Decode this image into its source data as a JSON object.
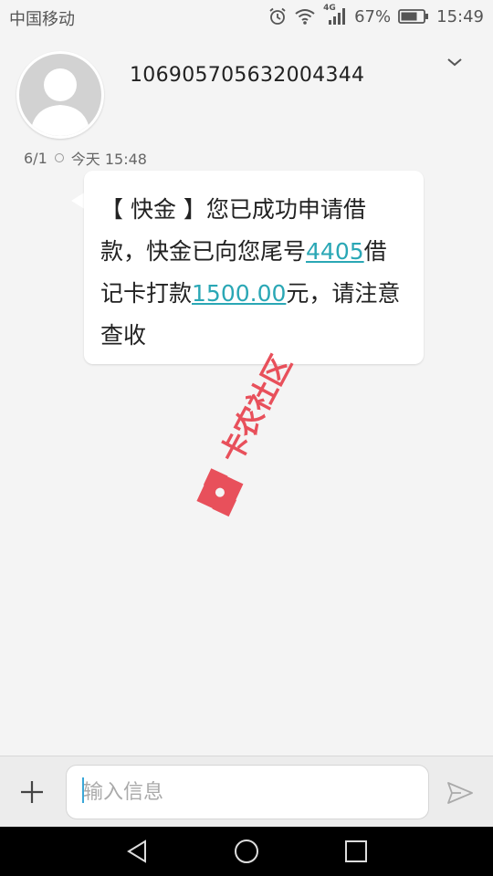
{
  "status_bar": {
    "carrier": "中国移动",
    "network": "4G",
    "battery": "67%",
    "time": "15:49"
  },
  "header": {
    "contact": "106905705632004344",
    "expand_icon": "chevron-down-icon"
  },
  "message": {
    "date": "6/1",
    "time": "今天 15:48",
    "parts": {
      "p1": "【 快金 】您已成功申请借款，快金已向您尾号",
      "card_tail": "4405",
      "p2": "借记卡打款",
      "amount": "1500.00",
      "p3": "元，请注意查收"
    }
  },
  "watermark": {
    "text": "卡农社区"
  },
  "input": {
    "placeholder": "输入信息"
  },
  "colors": {
    "link": "#2aa7b5",
    "watermark": "#e8505b"
  }
}
